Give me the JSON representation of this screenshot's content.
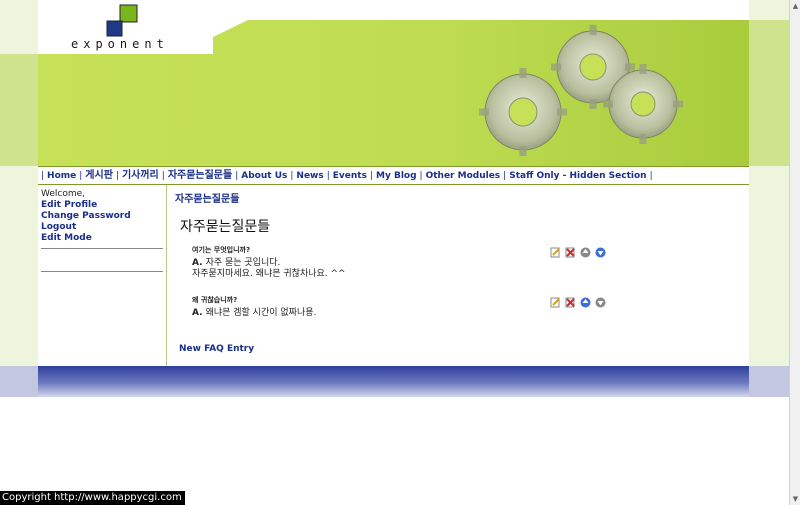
{
  "brand": {
    "name": "exponent"
  },
  "nav": {
    "items": [
      {
        "label": "Home"
      },
      {
        "label": "게시판"
      },
      {
        "label": "기사꺼리"
      },
      {
        "label": "자주묻는질문들"
      },
      {
        "label": "About Us"
      },
      {
        "label": "News"
      },
      {
        "label": "Events"
      },
      {
        "label": "My Blog"
      },
      {
        "label": "Other Modules"
      },
      {
        "label": "Staff Only - Hidden Section"
      }
    ]
  },
  "sidebar": {
    "welcome": "Welcome,",
    "links": [
      "Edit Profile",
      "Change Password",
      "Logout",
      "Edit Mode"
    ]
  },
  "main": {
    "breadcrumb": "자주묻는질문들",
    "title": "자주묻는질문들",
    "faqs": [
      {
        "question": "여기는 무엇입니까?",
        "answer_prefix": "A.",
        "answer_lines": [
          "자주 묻는 곳입니다.",
          "자주묻지마세요. 왜냐믄 귀찮차나요. ^^"
        ]
      },
      {
        "question": "왜 귀찮습니까?",
        "answer_prefix": "A.",
        "answer_lines": [
          "왜냐믄 겜할 시간이 없짜나용."
        ]
      }
    ],
    "new_entry": "New FAQ Entry",
    "action_icons": [
      "edit-icon",
      "delete-icon",
      "move-up-icon",
      "move-down-icon"
    ]
  },
  "footer": {
    "copyright": "Copyright   http://www.happycgi.com"
  },
  "colors": {
    "header_green": "#c6e157",
    "link_blue": "#1a2f8a",
    "footer_blue": "#2d3e9c",
    "logo_green": "#7ab51d",
    "logo_blue": "#1f3a8a"
  }
}
